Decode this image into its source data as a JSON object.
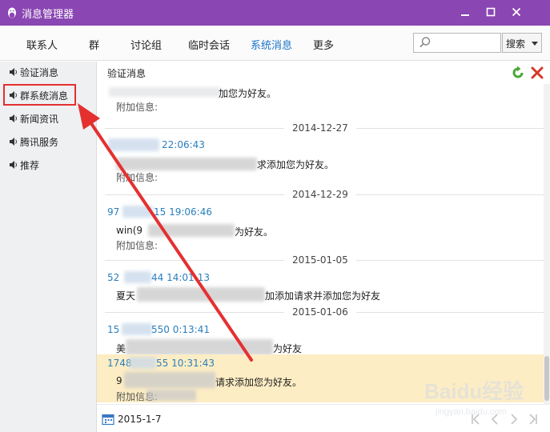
{
  "window": {
    "title": "消息管理器",
    "icons": {
      "app": "qq-penguin-icon",
      "minimize": "minimize-icon",
      "maximize": "maximize-icon",
      "close": "close-icon"
    }
  },
  "tabs": [
    {
      "label": "联系人"
    },
    {
      "label": "群"
    },
    {
      "label": "讨论组"
    },
    {
      "label": "临时会话"
    },
    {
      "label": "系统消息",
      "active": true
    },
    {
      "label": "更多"
    }
  ],
  "search": {
    "placeholder": "",
    "value": "",
    "button_label": "搜索",
    "icon": "search-icon"
  },
  "sidebar": {
    "items": [
      {
        "label": "验证消息",
        "icon": "speaker-icon"
      },
      {
        "label": "群系统消息",
        "icon": "speaker-icon",
        "highlighted": true
      },
      {
        "label": "新闻资讯",
        "icon": "speaker-icon"
      },
      {
        "label": "腾讯服务",
        "icon": "speaker-icon"
      },
      {
        "label": "推荐",
        "icon": "speaker-icon"
      }
    ]
  },
  "main": {
    "section_title": "验证消息",
    "toolbar": {
      "refresh_icon": "refresh-icon",
      "delete_icon": "delete-icon"
    },
    "messages": [
      {
        "head": "",
        "body": "加您为好友。",
        "extra": "附加信息:"
      },
      {
        "date": "2014-12-27"
      },
      {
        "head": "22:06:43",
        "body": "求添加您为好友。",
        "extra": "附加信息:"
      },
      {
        "date": "2014-12-29"
      },
      {
        "head": "97",
        "head2": "15 19:06:46",
        "body": "win(9",
        "body2": "为好友。",
        "extra": "附加信息:"
      },
      {
        "date": "2015-01-05"
      },
      {
        "head": "52",
        "head2": "44 14:01:13",
        "body": "夏天",
        "body2": "加添加请求并添加您为好友"
      },
      {
        "date": "2015-01-06"
      },
      {
        "head": "15",
        "head2": "550 0:13:41",
        "body": "美",
        "body2": "为好友"
      },
      {
        "head": "1748",
        "head2": "55 10:31:43",
        "body": "9",
        "body2": "请求添加您为好友。",
        "extra": "附加信息:",
        "highlight": true
      }
    ]
  },
  "bottom": {
    "date_value": "2015-1-7",
    "calendar_icon": "calendar-icon",
    "pager_icons": [
      "first-page-icon",
      "prev-page-icon",
      "next-page-icon",
      "last-page-icon"
    ]
  },
  "watermark": {
    "brand": "Baidu经验",
    "url": "jingyan.baidu.com"
  },
  "colors": {
    "titlebar": "#8a46b2",
    "active_tab": "#1a73c8",
    "highlight_row": "#fdedc4",
    "annotation": "#e53030",
    "time_text": "#2a7fbe"
  }
}
